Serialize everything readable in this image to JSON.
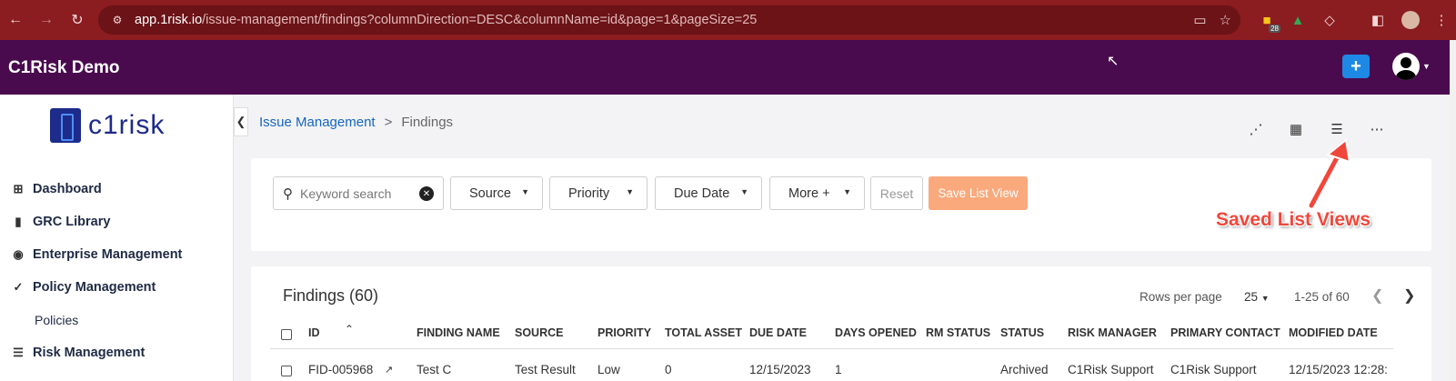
{
  "browser": {
    "url_host": "app.1risk.io",
    "url_path": "/issue-management/findings?columnDirection=DESC&columnName=id&page=1&pageSize=25",
    "extension_badge": "28"
  },
  "app": {
    "title": "C1Risk Demo",
    "logo_text": "c1risk",
    "add_icon": "+"
  },
  "sidebar": {
    "items": [
      {
        "label": "Dashboard",
        "icon": "grid-icon"
      },
      {
        "label": "GRC Library",
        "icon": "book-icon"
      },
      {
        "label": "Enterprise Management",
        "icon": "globe-icon"
      },
      {
        "label": "Policy Management",
        "icon": "check-icon"
      },
      {
        "label": "Risk Management",
        "icon": "list-icon"
      }
    ],
    "sub_items": [
      "Policies"
    ]
  },
  "breadcrumb": {
    "parent": "Issue Management",
    "separator": ">",
    "current": "Findings"
  },
  "filters": {
    "search_placeholder": "Keyword search",
    "source": "Source",
    "priority": "Priority",
    "due_date": "Due Date",
    "more": "More +",
    "reset": "Reset",
    "save_list_view": "Save List View"
  },
  "annotation": {
    "text": "Saved List Views",
    "color": "#f0473b"
  },
  "findings": {
    "title": "Findings (60)",
    "rows_per_page_label": "Rows per page",
    "rows_per_page_value": "25",
    "range": "1-25 of 60",
    "columns": [
      "ID",
      "FINDING NAME",
      "SOURCE",
      "PRIORITY",
      "TOTAL ASSET",
      "DUE DATE",
      "DAYS OPENED",
      "RM STATUS",
      "STATUS",
      "RISK MANAGER",
      "PRIMARY CONTACT",
      "MODIFIED DATE"
    ],
    "rows": [
      {
        "id": "FID-005968",
        "finding_name": "Test C",
        "source": "Test Result",
        "priority": "Low",
        "total_asset": "0",
        "due_date": "12/15/2023",
        "days_opened": "1",
        "rm_status": "",
        "status": "Archived",
        "risk_manager": "C1Risk Support",
        "primary_contact": "C1Risk Support",
        "modified_date": "12/15/2023 12:28:"
      }
    ]
  },
  "colors": {
    "browser_bar": "#8b1c20",
    "app_header": "#4a0b4e",
    "link": "#1565c0",
    "save_button": "#f9a97c",
    "folder_button": "#1e88e5"
  }
}
